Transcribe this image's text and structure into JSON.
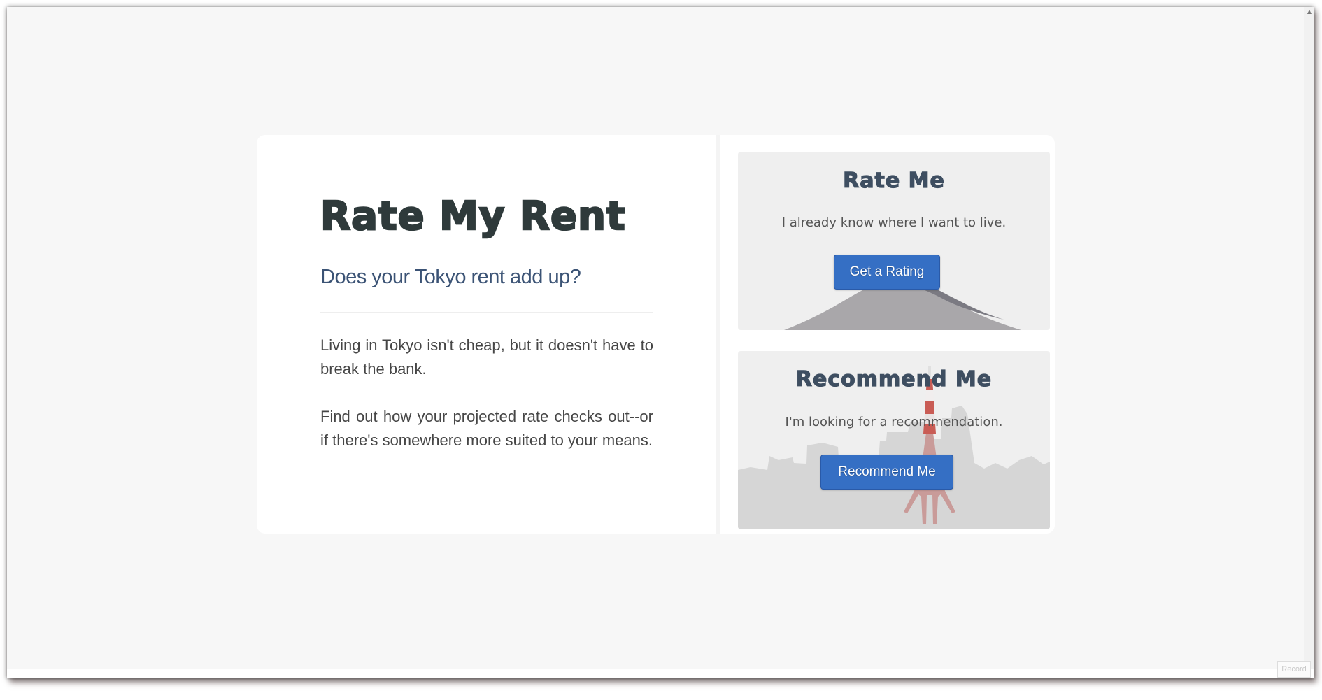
{
  "hero": {
    "title": "Rate My Rent",
    "subtitle": "Does your Tokyo rent add up?",
    "paragraphs": [
      "Living in Tokyo isn't cheap, but it doesn't have to break the bank.",
      "Find out how your projected rate checks out--or if there's somewhere more suited to your means."
    ]
  },
  "cards": {
    "rate": {
      "title": "Rate Me",
      "text": "I already know where I want to live.",
      "button_label": "Get a Rating",
      "illustration": "mount-fuji-illustration"
    },
    "recommend": {
      "title": "Recommend Me",
      "text": "I'm looking for a recommendation.",
      "button_label": "Recommend Me",
      "illustration": "tokyo-skyline-illustration"
    }
  },
  "badge": {
    "label": "Record"
  },
  "colors": {
    "background": "#f7f7f7",
    "card": "#ffffff",
    "title": "#2f3a3b",
    "subtitle": "#3b5375",
    "button": "#356fc4",
    "option_card": "#efefef"
  }
}
